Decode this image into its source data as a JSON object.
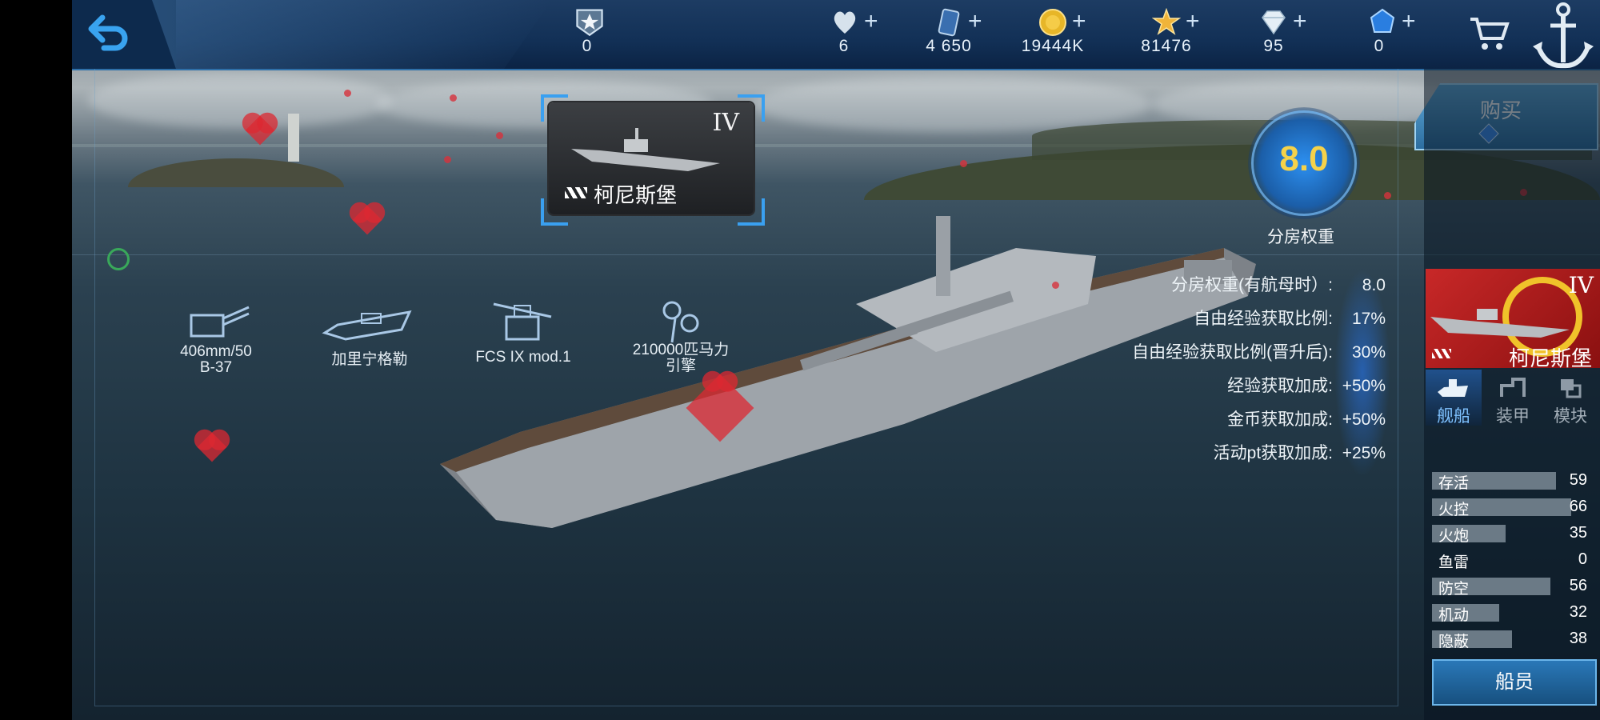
{
  "resources": [
    {
      "name": "rank",
      "icon": "rank-star-badge-icon",
      "value": "0",
      "has_plus": false
    },
    {
      "name": "hearts",
      "icon": "heart-icon",
      "value": "6",
      "has_plus": true
    },
    {
      "name": "cards",
      "icon": "card-icon",
      "value": "4 650",
      "has_plus": true
    },
    {
      "name": "gold",
      "icon": "gold-coin-icon",
      "value": "19444K",
      "has_plus": true
    },
    {
      "name": "stars",
      "icon": "star-icon",
      "value": "81476",
      "has_plus": true
    },
    {
      "name": "diamonds",
      "icon": "diamond-icon",
      "value": "95",
      "has_plus": true
    },
    {
      "name": "crystals",
      "icon": "blue-crystal-icon",
      "value": "0",
      "has_plus": true
    }
  ],
  "ship": {
    "name": "柯尼斯堡",
    "tier": "IV",
    "room_weight": "8.0",
    "room_weight_label": "分房权重"
  },
  "buy_label": "购买",
  "equipment": [
    {
      "icon": "main-gun-icon",
      "label": "406mm/50\nB-37"
    },
    {
      "icon": "hull-icon",
      "label": "加里宁格勒"
    },
    {
      "icon": "fire-control-icon",
      "label": "FCS IX mod.1"
    },
    {
      "icon": "engine-icon",
      "label": "210000匹马力\n引擎"
    }
  ],
  "stats": [
    {
      "label": "分房权重(有航母时）:",
      "value": "8.0"
    },
    {
      "label": "自由经验获取比例:",
      "value": "17%"
    },
    {
      "label": "自由经验获取比例(晋升后):",
      "value": "30%"
    },
    {
      "label": "经验获取加成:",
      "value": "+50%"
    },
    {
      "label": "金币获取加成:",
      "value": "+50%"
    },
    {
      "label": "活动pt获取加成:",
      "value": "+25%"
    }
  ],
  "tabs": [
    {
      "label": "舰船",
      "icon": "ship-tab-icon",
      "active": true
    },
    {
      "label": "装甲",
      "icon": "armor-tab-icon",
      "active": false
    },
    {
      "label": "模块",
      "icon": "module-tab-icon",
      "active": false
    }
  ],
  "attributes": [
    {
      "label": "存活",
      "value": 59
    },
    {
      "label": "火控",
      "value": 66
    },
    {
      "label": "火炮",
      "value": 35
    },
    {
      "label": "鱼雷",
      "value": 0
    },
    {
      "label": "防空",
      "value": 56
    },
    {
      "label": "机动",
      "value": 32
    },
    {
      "label": "隐蔽",
      "value": 38
    }
  ],
  "crew_label": "船员",
  "colors": {
    "accent_blue": "#3aa0f0",
    "gold_text": "#f5d24a",
    "topbar": "#123056"
  }
}
